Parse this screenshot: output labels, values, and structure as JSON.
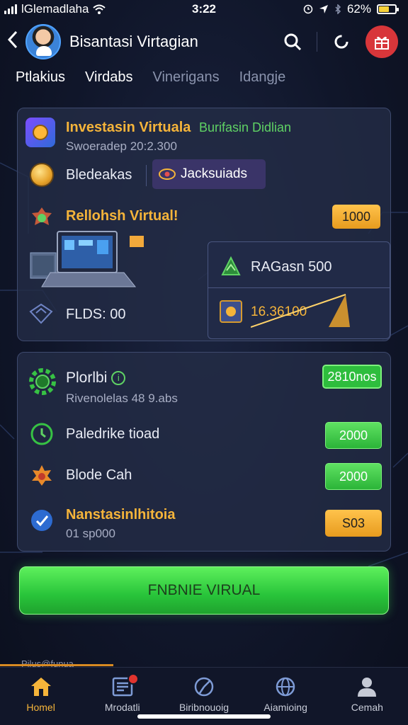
{
  "status": {
    "carrier": "lGlemadlaha",
    "time": "3:22",
    "battery": "62%",
    "battery_level": 0.62
  },
  "header": {
    "title": "Bisantasi Virtagian"
  },
  "tabs": [
    "Ptlakius",
    "Virdabs",
    "Vinerigans",
    "Idangje"
  ],
  "card1": {
    "title": "Investasin Virtuala",
    "subtitle_green": "Burifasin Didlian",
    "meta": "Swoeradep 20:2.300",
    "balance_label": "Bledeakas",
    "jackpot_label": "Jacksuiads",
    "refresh_label": "Rellohsh Virtual!",
    "refresh_value": "1000",
    "rate_label": "RAGasn 500",
    "flow_label": "FLDS: 00",
    "chart_value": "16.36100"
  },
  "card2": {
    "title": "Plorlbi",
    "subtitle": "Rivenolelas 48 9.abs",
    "title_badge": "2810nos",
    "rows": [
      {
        "label": "Paledrike tioad",
        "value": "2000",
        "color": "green"
      },
      {
        "label": "Blode Cah",
        "value": "2000",
        "color": "green"
      },
      {
        "label": "Nanstasinlhitoia",
        "sub": "01 sp000",
        "value": "S03",
        "color": "orange"
      }
    ]
  },
  "cta": {
    "label": "FNBNIE VIRUAL"
  },
  "footer_peek": "Pilus@funua",
  "nav": [
    {
      "label": "Homel",
      "icon": "home-icon",
      "active": true
    },
    {
      "label": "Mrodatli",
      "icon": "news-icon",
      "badge": true
    },
    {
      "label": "Biribnouoig",
      "icon": "chart-circle-icon"
    },
    {
      "label": "Aiamioing",
      "icon": "globe-icon"
    },
    {
      "label": "Cemah",
      "icon": "user-icon"
    }
  ],
  "colors": {
    "accent_gold": "#f5b43a",
    "accent_green": "#2ebd3d",
    "danger_red": "#d8363a",
    "background": "#10162a"
  }
}
